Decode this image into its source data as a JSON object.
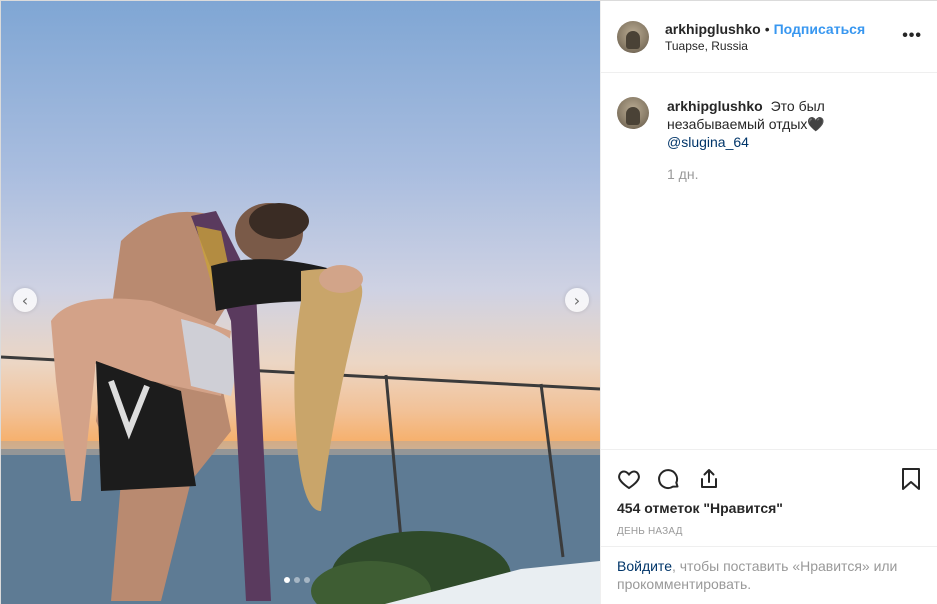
{
  "post": {
    "author": {
      "username": "arkhipglushko",
      "separator": "•",
      "follow_label": "Подписаться",
      "location": "Tuapse, Russia"
    },
    "more_label": "•••",
    "caption": {
      "username": "arkhipglushko",
      "text": "Это был незабываемый отдых🖤",
      "mention": "@slugina_64",
      "age": "1 дн."
    },
    "likes": "454 отметок \"Нравится\"",
    "date": "ДЕНЬ НАЗАД",
    "login": {
      "link": "Войдите",
      "rest": ", чтобы поставить «Нравится» или прокомментировать."
    }
  },
  "carousel": {
    "prev": "‹",
    "next": "›",
    "current_slide": 1,
    "total_slides": 3
  },
  "icons": [
    "heart-icon",
    "comment-icon",
    "share-icon",
    "bookmark-icon",
    "more-icon",
    "chevron-left-icon",
    "chevron-right-icon"
  ]
}
